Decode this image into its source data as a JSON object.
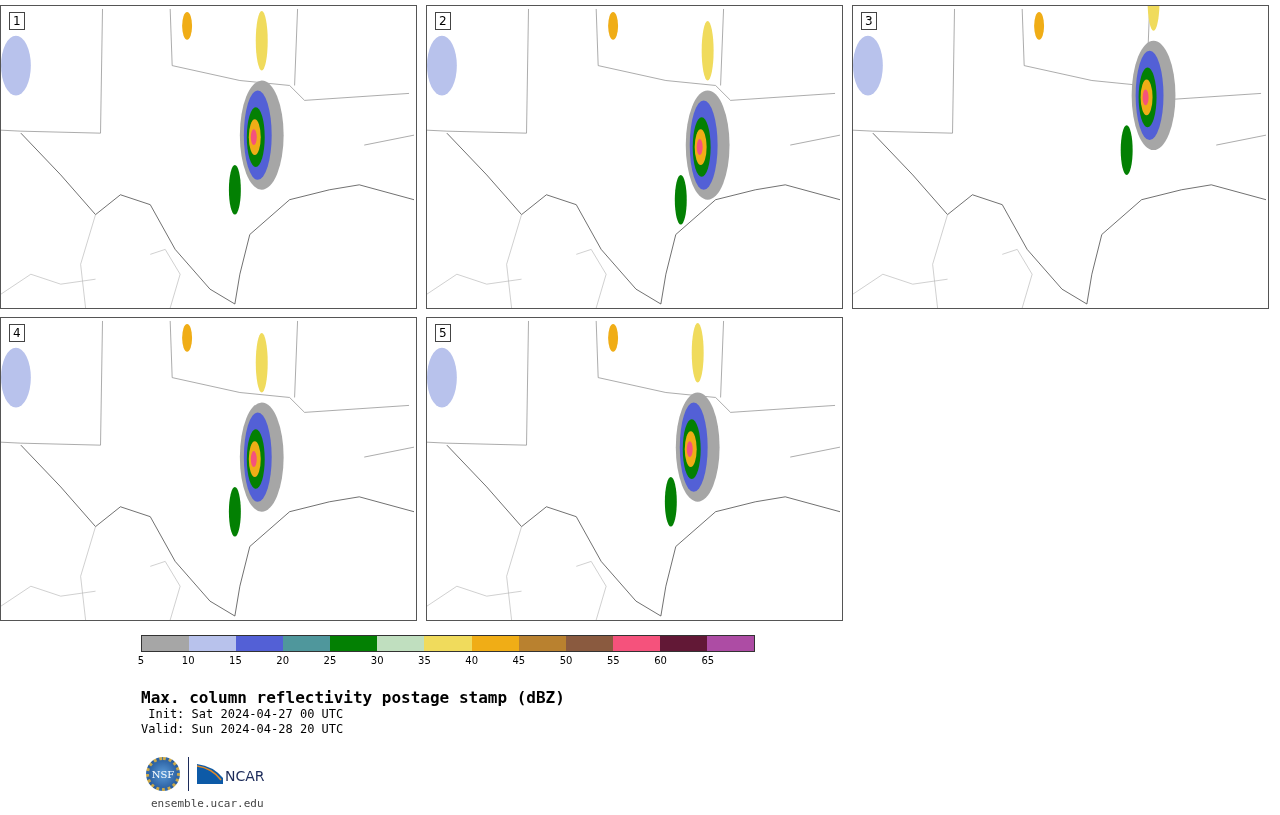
{
  "panels": [
    {
      "label": "1"
    },
    {
      "label": "2"
    },
    {
      "label": "3"
    },
    {
      "label": "4"
    },
    {
      "label": "5"
    }
  ],
  "colorbar": {
    "segments": [
      {
        "color": "#a6a6a6"
      },
      {
        "color": "#b8c2ec"
      },
      {
        "color": "#5360d6"
      },
      {
        "color": "#4f979c"
      },
      {
        "color": "#038003"
      },
      {
        "color": "#c0dfbf"
      },
      {
        "color": "#f0db5c"
      },
      {
        "color": "#f0ad16"
      },
      {
        "color": "#b9812f"
      },
      {
        "color": "#8a5a3f"
      },
      {
        "color": "#f5527c"
      },
      {
        "color": "#621836"
      },
      {
        "color": "#ad4ca4"
      }
    ],
    "ticks": [
      "5",
      "10",
      "15",
      "20",
      "25",
      "30",
      "35",
      "40",
      "45",
      "50",
      "55",
      "60",
      "65"
    ]
  },
  "title": "Max. column reflectivity postage stamp (dBZ)",
  "init": " Init: Sat 2024-04-27 00 UTC",
  "valid": "Valid: Sun 2024-04-28 20 UTC",
  "logos": {
    "nsf": "NSF",
    "ncar": "NCAR"
  },
  "footer": "ensemble.ucar.edu"
}
